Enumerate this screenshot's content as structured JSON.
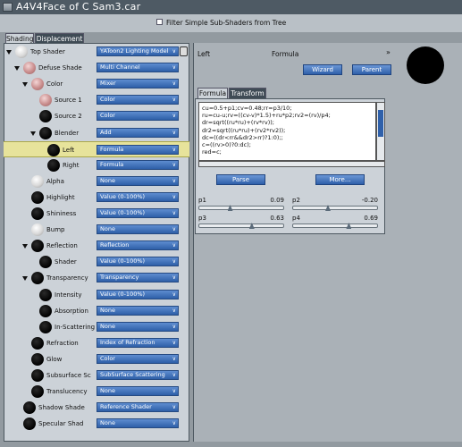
{
  "window": {
    "title": "A4V4Face of C  Sam3.car"
  },
  "filter": {
    "label": "Filter Simple Sub-Shaders from Tree",
    "checked": false
  },
  "left_tabs": [
    "Shading",
    "Displacement"
  ],
  "tree": [
    {
      "label": "Top Shader",
      "value": "YAToon2 Lighting Model",
      "ball": "white"
    },
    {
      "label": "Defuse Shade",
      "value": "Multi Channel",
      "ball": "pink"
    },
    {
      "label": "Color",
      "value": "Mixer",
      "ball": "pink"
    },
    {
      "label": "Source 1",
      "value": "Color",
      "ball": "pink"
    },
    {
      "label": "Source 2",
      "value": "Color",
      "ball": "black"
    },
    {
      "label": "Blender",
      "value": "Add",
      "ball": "black"
    },
    {
      "label": "Left",
      "value": "Formula",
      "ball": "black",
      "selected": true
    },
    {
      "label": "Right",
      "value": "Formula",
      "ball": "black"
    },
    {
      "label": "Alpha",
      "value": "None",
      "ball": "white"
    },
    {
      "label": "Highlight",
      "value": "Value (0-100%)",
      "ball": "black"
    },
    {
      "label": "Shininess",
      "value": "Value (0-100%)",
      "ball": "black"
    },
    {
      "label": "Bump",
      "value": "None",
      "ball": "white"
    },
    {
      "label": "Reflection",
      "value": "Reflection",
      "ball": "black"
    },
    {
      "label": "Shader",
      "value": "Value (0-100%)",
      "ball": "black"
    },
    {
      "label": "Transparency",
      "value": "Transparency",
      "ball": "black"
    },
    {
      "label": "Intensity",
      "value": "Value (0-100%)",
      "ball": "black"
    },
    {
      "label": "Absorption",
      "value": "None",
      "ball": "black"
    },
    {
      "label": "In-Scattering",
      "value": "None",
      "ball": "black"
    },
    {
      "label": "Refraction",
      "value": "Index of Refraction",
      "ball": "black"
    },
    {
      "label": "Glow",
      "value": "Color",
      "ball": "black"
    },
    {
      "label": "Subsurface Sc",
      "value": "SubSurface Scattering",
      "ball": "black"
    },
    {
      "label": "Translucency",
      "value": "None",
      "ball": "black"
    },
    {
      "label": "Shadow Shade",
      "value": "Reference Shader",
      "ball": "black"
    },
    {
      "label": "Specular Shad",
      "value": "None",
      "ball": "black"
    }
  ],
  "detail": {
    "node": "Left",
    "type": "Formula",
    "wizard": "Wizard",
    "parent": "Parent"
  },
  "right_tabs": [
    "Formula",
    "Transform"
  ],
  "formula_lines": [
    "cu=0.5+p1;cv=0.48;rr=p3/10;",
    "ru=cu-u;rv=((cv-v)*1.5)+ru*p2;rv2=(rv)/p4;",
    "dr=sqrt((ru*ru)+(rv*rv));",
    "dr2=sqrt((ru*ru)+(rv2*rv2));",
    "dc=((dr<rr&&dr2>rr)?1:0);;",
    "c=((rv>0)?0:dc);",
    "red=c;"
  ],
  "buttons": {
    "parse": "Parse",
    "more": "More..."
  },
  "params": [
    {
      "name": "p1",
      "value": "0.09",
      "level": 0.35
    },
    {
      "name": "p2",
      "value": "-0.20",
      "level": 0.4
    },
    {
      "name": "p3",
      "value": "0.63",
      "level": 0.62
    },
    {
      "name": "p4",
      "value": "0.69",
      "level": 0.66
    }
  ]
}
